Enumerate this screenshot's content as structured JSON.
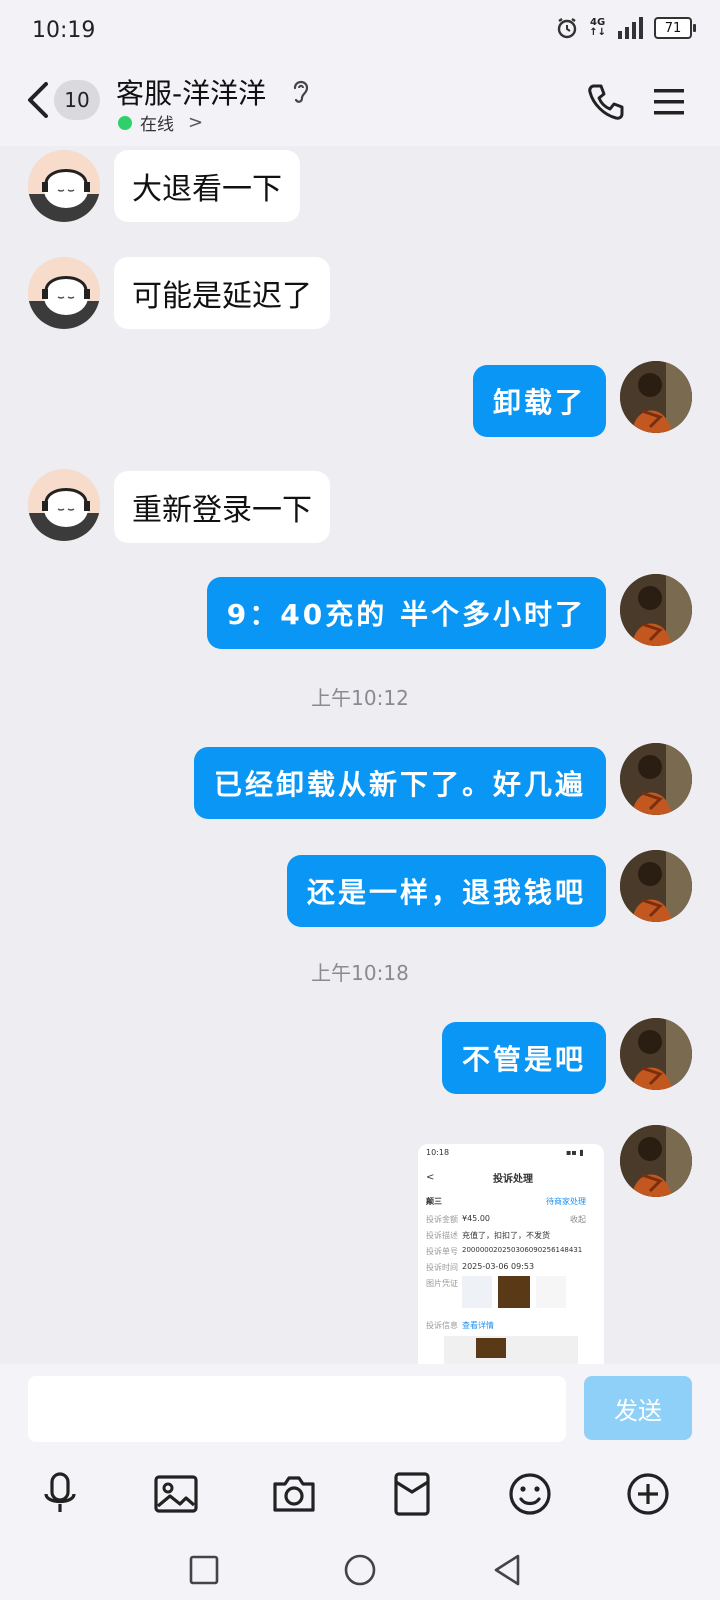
{
  "status_bar": {
    "time": "10:19",
    "network": "4G",
    "battery": "71"
  },
  "header": {
    "unread_count": "10",
    "title": "客服-洋洋洋",
    "status": "在线"
  },
  "messages": [
    {
      "side": "left",
      "text": "大退看一下"
    },
    {
      "side": "left",
      "text": "可能是延迟了"
    },
    {
      "side": "right",
      "text": "卸载了"
    },
    {
      "side": "left",
      "text": "重新登录一下"
    },
    {
      "side": "right",
      "text": "9：40充的 半个多小时了"
    },
    {
      "side": "timestamp",
      "text": "上午10:12"
    },
    {
      "side": "right",
      "text": "已经卸载从新下了。好几遍"
    },
    {
      "side": "right",
      "text": "还是一样，退我钱吧"
    },
    {
      "side": "timestamp",
      "text": "上午10:18"
    },
    {
      "side": "right",
      "text": "不管是吧"
    }
  ],
  "screenshot_message": {
    "time": "10:18",
    "title": "投诉处理",
    "merchant": "颠三",
    "status": "待商家处理",
    "collapse": "收起",
    "rows": [
      {
        "label": "投诉金额",
        "value": "¥45.00"
      },
      {
        "label": "投诉描述",
        "value": "充值了，扣扣了，不发货"
      },
      {
        "label": "投诉单号",
        "value": "200000020250306090256148431"
      },
      {
        "label": "投诉时间",
        "value": "2025-03-06 09:53"
      },
      {
        "label": "图片凭证",
        "value": ""
      },
      {
        "label": "投诉信息",
        "value": "查看详情"
      }
    ]
  },
  "composer": {
    "placeholder": "",
    "send_label": "发送"
  },
  "colors": {
    "bubble_blue": "#0a96f5",
    "online_green": "#2fd069",
    "send_disabled": "#8fd0f8"
  }
}
